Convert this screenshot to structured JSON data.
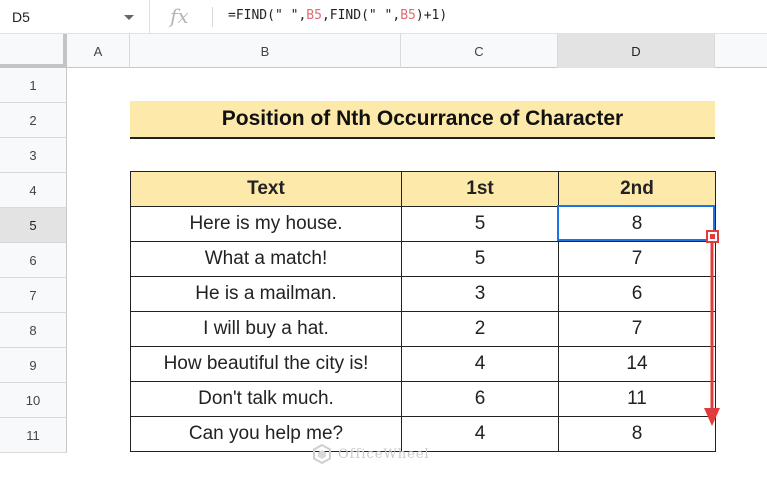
{
  "formula_bar": {
    "cell_ref": "D5",
    "fx_label": "fx",
    "formula_parts": [
      "=FIND(\" \",",
      "B5",
      ",FIND(\" \",",
      "B5",
      ")+1)"
    ]
  },
  "columns": [
    "A",
    "B",
    "C",
    "D"
  ],
  "rows": [
    "1",
    "2",
    "3",
    "4",
    "5",
    "6",
    "7",
    "8",
    "9",
    "10",
    "11"
  ],
  "title": "Position of Nth Occurrance of Character",
  "table": {
    "headers": [
      "Text",
      "1st",
      "2nd"
    ],
    "rows": [
      [
        "Here is my house.",
        "5",
        "8"
      ],
      [
        "What a match!",
        "5",
        "7"
      ],
      [
        "He is a mailman.",
        "3",
        "6"
      ],
      [
        "I will buy a hat.",
        "2",
        "7"
      ],
      [
        "How beautiful the city is!",
        "4",
        "14"
      ],
      [
        "Don't talk much.",
        "6",
        "11"
      ],
      [
        "Can you help me?",
        "4",
        "8"
      ]
    ]
  },
  "watermark": "OfficeWheel",
  "colors": {
    "title_bg": "#fde9a9",
    "selection": "#1a73e8",
    "arrow": "#e03c3c"
  }
}
